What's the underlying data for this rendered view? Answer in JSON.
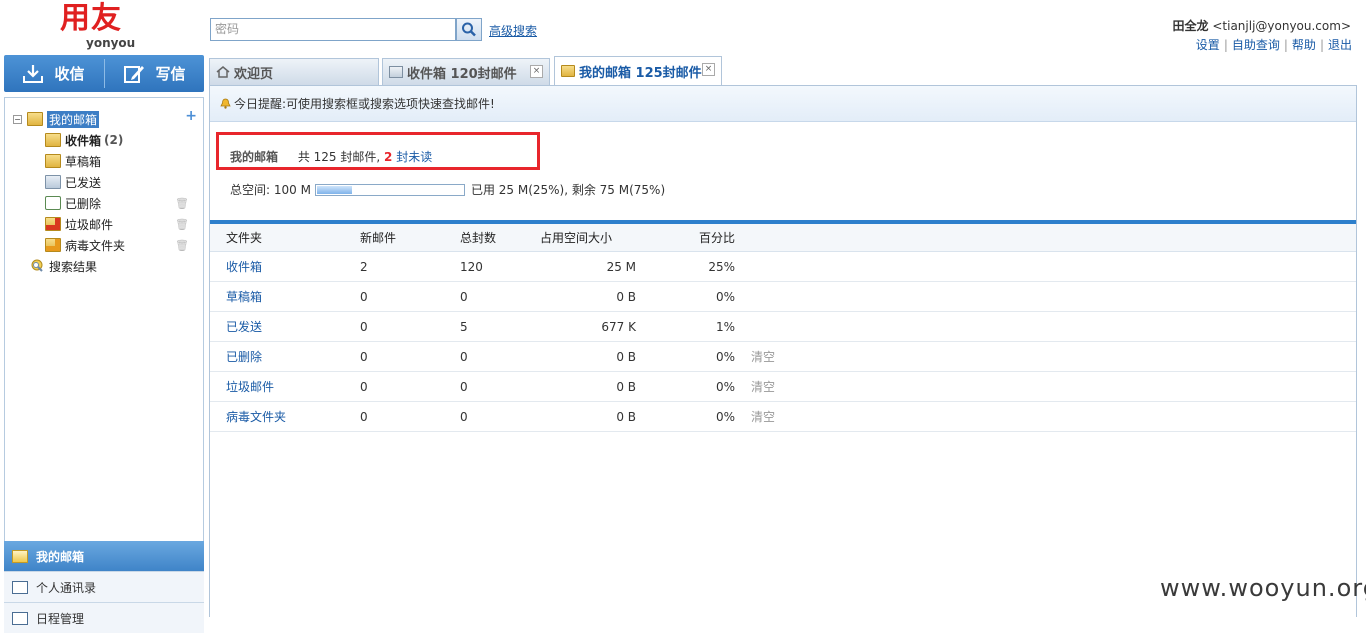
{
  "brand": {
    "logo_main": "用友",
    "logo_sub": "yonyou",
    "red": "#e02020"
  },
  "search": {
    "placeholder": "密码",
    "advanced_label": "高级搜索"
  },
  "user": {
    "name": "田全龙",
    "email": "<tianjlj@yonyou.com>",
    "links": [
      "设置",
      "自助查询",
      "帮助",
      "退出"
    ]
  },
  "actions": {
    "receive": "收信",
    "compose": "写信"
  },
  "tree": {
    "root": "我的邮箱",
    "items": [
      {
        "label": "收件箱",
        "count": "(2)",
        "icon": "inbox-folder-icon"
      },
      {
        "label": "草稿箱",
        "icon": "drafts-folder-icon"
      },
      {
        "label": "已发送",
        "icon": "sent-folder-icon"
      },
      {
        "label": "已删除",
        "icon": "deleted-folder-icon"
      },
      {
        "label": "垃圾邮件",
        "icon": "spam-folder-icon"
      },
      {
        "label": "病毒文件夹",
        "icon": "virus-folder-icon"
      }
    ],
    "search_results": "搜索结果"
  },
  "bottom_nav": {
    "mailbox": "我的邮箱",
    "contacts": "个人通讯录",
    "schedule": "日程管理"
  },
  "tabs": [
    {
      "label": "欢迎页"
    },
    {
      "label": "收件箱 120封邮件"
    },
    {
      "label": "我的邮箱 125封邮件"
    }
  ],
  "notice": "今日提醒:可使用搜索框或搜索选项快速查找邮件!",
  "summary": {
    "mailbox_name": "我的邮箱",
    "total_text": "共 125 封邮件,",
    "unread_count": "2",
    "unread_label": "封未读"
  },
  "space": {
    "label": "总空间: 100 M",
    "used_text": "已用 25 M(25%), 剩余 75 M(75%)",
    "used_fraction": 0.25
  },
  "table": {
    "headers": [
      "文件夹",
      "新邮件",
      "总封数",
      "占用空间大小",
      "百分比"
    ],
    "rows": [
      {
        "name": "收件箱",
        "new": "2",
        "total": "120",
        "size": "25 M",
        "pct": "25%",
        "action": ""
      },
      {
        "name": "草稿箱",
        "new": "0",
        "total": "0",
        "size": "0 B",
        "pct": "0%",
        "action": ""
      },
      {
        "name": "已发送",
        "new": "0",
        "total": "5",
        "size": "677 K",
        "pct": "1%",
        "action": ""
      },
      {
        "name": "已删除",
        "new": "0",
        "total": "0",
        "size": "0 B",
        "pct": "0%",
        "action": "清空"
      },
      {
        "name": "垃圾邮件",
        "new": "0",
        "total": "0",
        "size": "0 B",
        "pct": "0%",
        "action": "清空"
      },
      {
        "name": "病毒文件夹",
        "new": "0",
        "total": "0",
        "size": "0 B",
        "pct": "0%",
        "action": "清空"
      }
    ]
  },
  "watermark": "www.wooyun.org",
  "colors": {
    "accent_blue": "#2d7fcc",
    "highlight_red": "#e8262c",
    "link": "#1a5ba6"
  }
}
